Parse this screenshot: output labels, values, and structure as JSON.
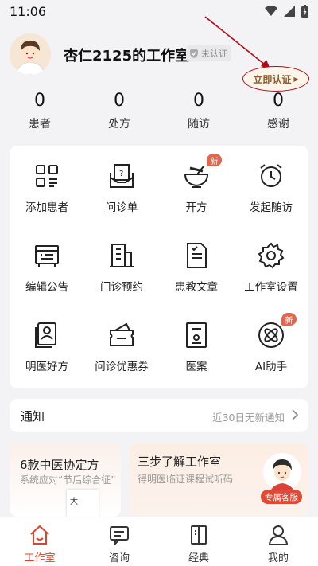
{
  "status_bar": {
    "time": "11:06"
  },
  "header": {
    "studio_name": "杏仁2125的工作室",
    "verify_status": "未认证",
    "verify_now": "立即认证"
  },
  "stats": [
    {
      "value": "0",
      "label": "患者"
    },
    {
      "value": "0",
      "label": "处方"
    },
    {
      "value": "0",
      "label": "随访"
    },
    {
      "value": "0",
      "label": "感谢"
    }
  ],
  "grid": [
    {
      "label": "添加患者",
      "icon": "scan-icon"
    },
    {
      "label": "问诊单",
      "icon": "inquiry-form-icon"
    },
    {
      "label": "开方",
      "icon": "mortar-icon",
      "badge": "新"
    },
    {
      "label": "发起随访",
      "icon": "alarm-clock-icon"
    },
    {
      "label": "编辑公告",
      "icon": "announcement-icon"
    },
    {
      "label": "门诊预约",
      "icon": "building-icon"
    },
    {
      "label": "患教文章",
      "icon": "article-icon"
    },
    {
      "label": "工作室设置",
      "icon": "gear-icon"
    },
    {
      "label": "明医好方",
      "icon": "doctor-card-icon"
    },
    {
      "label": "问诊优惠券",
      "icon": "coupon-icon"
    },
    {
      "label": "医案",
      "icon": "case-file-icon"
    },
    {
      "label": "AI助手",
      "icon": "ai-orbit-icon",
      "badge": "新"
    }
  ],
  "notice": {
    "title": "通知",
    "status": "近30日无新通知"
  },
  "promo_left": {
    "title": "6款中医协定方",
    "subtitle": "系统应对“节后综合征”",
    "book_text": "大"
  },
  "promo_right": {
    "title": "三步了解工作室",
    "subtitle": "得明医临证课程试听码",
    "service_label": "专属客服"
  },
  "bottom_nav": [
    {
      "label": "工作室",
      "icon": "house-icon",
      "active": true
    },
    {
      "label": "咨询",
      "icon": "chat-icon"
    },
    {
      "label": "经典",
      "icon": "book-icon"
    },
    {
      "label": "我的",
      "icon": "person-icon"
    }
  ],
  "colors": {
    "accent": "#d9432f",
    "badge": "#e0664f",
    "background": "#f3f3f5",
    "verify_text": "#8a5a2a",
    "annotation": "#b00a16"
  }
}
